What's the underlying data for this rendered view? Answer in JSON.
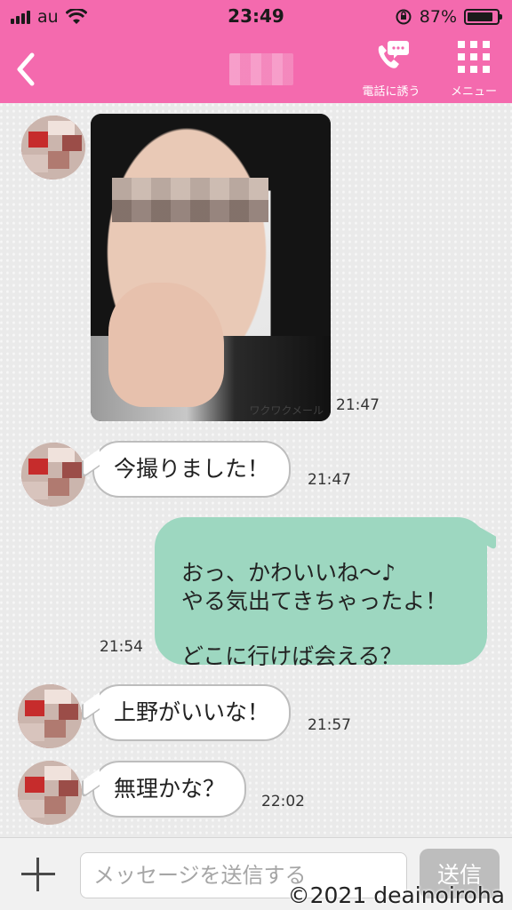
{
  "status_bar": {
    "carrier": "au",
    "time": "23:49",
    "battery_percent_label": "87%",
    "battery_level": 0.87
  },
  "header": {
    "call_label": "電話に誘う",
    "menu_label": "メニュー"
  },
  "messages": [
    {
      "side": "in",
      "type": "image",
      "watermark": "ワクワクメール",
      "time": "21:47"
    },
    {
      "side": "in",
      "type": "text",
      "text": "今撮りました！",
      "time": "21:47"
    },
    {
      "side": "out",
      "type": "text",
      "text": "おっ、かわいいね～♪\nやる気出てきちゃったよ！\n\nどこに行けば会える？",
      "time": "21:54"
    },
    {
      "side": "in",
      "type": "text",
      "text": "上野がいいな！",
      "time": "21:57"
    },
    {
      "side": "in",
      "type": "text",
      "text": "無理かな？",
      "time": "22:02"
    }
  ],
  "composer": {
    "placeholder": "メッセージを送信する",
    "send_label": "送信"
  },
  "credit": "©2021 deainoiroha",
  "colors": {
    "header_pink": "#f46aae",
    "outgoing_bubble": "#9dd7c0",
    "incoming_bubble": "#ffffff"
  }
}
